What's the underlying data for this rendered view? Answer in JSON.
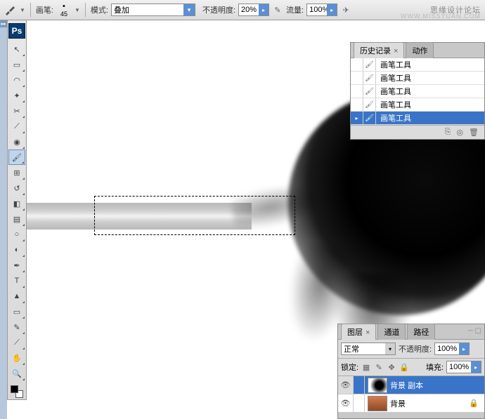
{
  "toolbar": {
    "brush_label": "画笔:",
    "brush_size": "45",
    "mode_label": "模式:",
    "mode_value": "叠加",
    "opacity_label": "不透明度:",
    "opacity_value": "20%",
    "flow_label": "流量:",
    "flow_value": "100%"
  },
  "watermark": {
    "line1": "思缘设计论坛",
    "line2": "WWW.MISSYUAN.COM"
  },
  "tools": [
    "move",
    "marquee",
    "lasso",
    "wand",
    "crop",
    "slice",
    "spot-heal",
    "brush",
    "stamp",
    "history-brush",
    "eraser",
    "gradient",
    "blur",
    "dodge",
    "pen",
    "type",
    "path-select",
    "shape",
    "notes",
    "eyedropper",
    "hand",
    "zoom"
  ],
  "tools_active": "brush",
  "history": {
    "tab_history": "历史记录",
    "tab_actions": "动作",
    "items": [
      {
        "label": "画笔工具"
      },
      {
        "label": "画笔工具"
      },
      {
        "label": "画笔工具"
      },
      {
        "label": "画笔工具"
      },
      {
        "label": "画笔工具"
      }
    ],
    "active_index": 4
  },
  "layers": {
    "tab_layers": "图层",
    "tab_channels": "通道",
    "tab_paths": "路径",
    "blend_mode": "正常",
    "opacity_label": "不透明度:",
    "opacity_value": "100%",
    "lock_label": "锁定:",
    "fill_label": "填充:",
    "fill_value": "100%",
    "items": [
      {
        "name": "背景 副本",
        "thumb": "fur",
        "locked": false
      },
      {
        "name": "背景",
        "thumb": "img",
        "locked": true
      }
    ],
    "active_index": 0
  }
}
